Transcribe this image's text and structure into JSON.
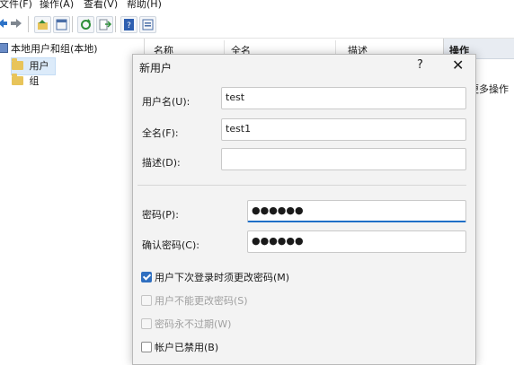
{
  "menubar": {
    "file": "文件(F)",
    "action": "操作(A)",
    "view": "查看(V)",
    "help": "帮助(H)"
  },
  "tree": {
    "root": "本地用户和组(本地)",
    "items": [
      {
        "label": "用户"
      },
      {
        "label": "组"
      }
    ]
  },
  "list_header": {
    "name": "名称",
    "fullname": "全名",
    "description": "描述"
  },
  "actions": {
    "header": "操作",
    "more": "更多操作"
  },
  "dialog": {
    "title": "新用户",
    "help": "?",
    "close": "✕",
    "username_label": "用户名(U):",
    "username_value": "test",
    "fullname_label": "全名(F):",
    "fullname_value": "test1",
    "description_label": "描述(D):",
    "description_value": "",
    "password_label": "密码(P):",
    "password_value": "●●●●●●",
    "confirm_label": "确认密码(C):",
    "confirm_value": "●●●●●●",
    "options": [
      {
        "label": "用户下次登录时须更改密码(M)",
        "checked": true,
        "disabled": false
      },
      {
        "label": "用户不能更改密码(S)",
        "checked": false,
        "disabled": true
      },
      {
        "label": "密码永不过期(W)",
        "checked": false,
        "disabled": true
      },
      {
        "label": "帐户已禁用(B)",
        "checked": false,
        "disabled": false
      }
    ]
  },
  "colors": {
    "accent": "#1f6fc7",
    "checkbox": "#2f6fc0",
    "folder": "#e8c45a"
  }
}
